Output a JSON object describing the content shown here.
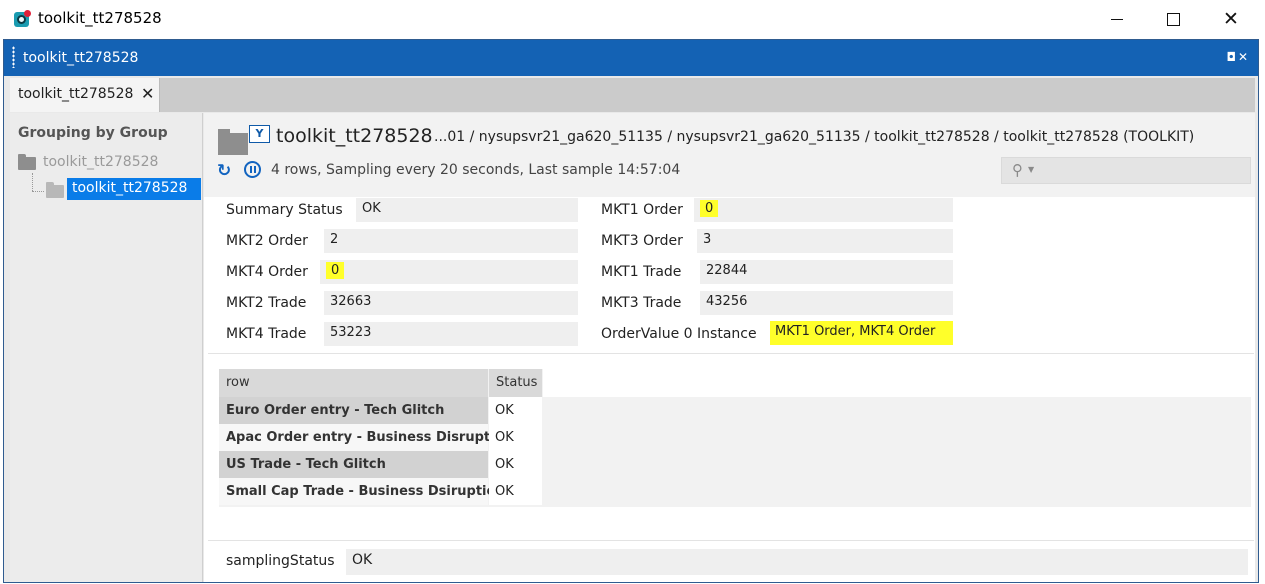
{
  "os_window": {
    "title": "toolkit_tt278528",
    "close_glyph": "✕"
  },
  "panel": {
    "title": "toolkit_tt278528",
    "controls": "◘✕"
  },
  "tab": {
    "label": "toolkit_tt278528",
    "close_glyph": "✕"
  },
  "tree": {
    "heading": "Grouping by Group",
    "root_label": "toolkit_tt278528",
    "child_label": "toolkit_tt278528"
  },
  "header": {
    "title": "toolkit_tt278528",
    "path": "...01 / nysupsvr21_ga620_51135 / nysupsvr21_ga620_51135 / toolkit_tt278528 / toolkit_tt278528 (TOOLKIT)",
    "filter_glyph": "Y",
    "status": "4 rows, Sampling every 20 seconds, Last sample 14:57:04",
    "search_placeholder": ""
  },
  "summary": {
    "summary_status_label": "Summary Status",
    "summary_status_value": "OK",
    "mkt1_order_label": "MKT1 Order",
    "mkt1_order_value": "0",
    "mkt2_order_label": "MKT2 Order",
    "mkt2_order_value": "2",
    "mkt3_order_label": "MKT3 Order",
    "mkt3_order_value": "3",
    "mkt4_order_label": "MKT4 Order",
    "mkt4_order_value": "0",
    "mkt1_trade_label": "MKT1 Trade",
    "mkt1_trade_value": "22844",
    "mkt2_trade_label": "MKT2 Trade",
    "mkt2_trade_value": "32663",
    "mkt3_trade_label": "MKT3 Trade",
    "mkt3_trade_value": "43256",
    "mkt4_trade_label": "MKT4 Trade",
    "mkt4_trade_value": "53223",
    "ordervalue_label": "OrderValue 0 Instance",
    "ordervalue_value": "MKT1 Order,    MKT4 Order"
  },
  "table": {
    "columns": [
      "row",
      "Status"
    ],
    "rows": [
      {
        "name": "Euro Order entry  - Tech Glitch",
        "status": "OK"
      },
      {
        "name": "Apac Order entry - Business Disruption",
        "status": "OK"
      },
      {
        "name": "US Trade - Tech Glitch",
        "status": "OK"
      },
      {
        "name": "Small Cap Trade - Business Dsiruption",
        "status": "OK"
      }
    ]
  },
  "footer": {
    "label": "samplingStatus",
    "value": "OK"
  },
  "colors": {
    "accent_blue": "#1462b4",
    "selection_blue": "#0a7ce8",
    "highlight_yellow": "#ffff2a"
  }
}
